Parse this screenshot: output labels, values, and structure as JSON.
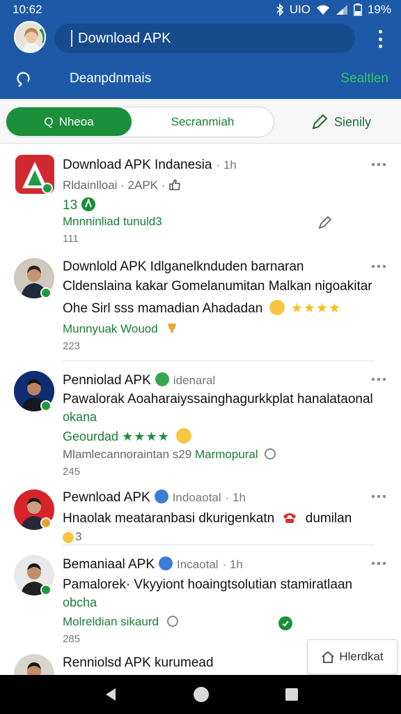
{
  "status_bar": {
    "time": "10:62",
    "network": "UIO",
    "battery": "19%"
  },
  "app_bar": {
    "search_text": "Download APK"
  },
  "sub_bar": {
    "title": "Deanpdnmais",
    "action": "Sealtlen"
  },
  "filters": {
    "active_label": "Nheoa",
    "active_prefix": "Q",
    "inactive_label": "Secranmiah",
    "right_label": "Sienily"
  },
  "feed": [
    {
      "title": "Download APK Indanesia",
      "time": "· 1h",
      "line1": "Rldainlloai · 2APK ·",
      "line2_num": "13",
      "line3": "Mnnninliad tunuld3",
      "count": "111"
    },
    {
      "title": "Downlold APK Idlganelknduden barnaran",
      "line1": "Cldenslaina kakar Gomelanumitan Malkan nigoakitar",
      "line2": "Ohe Sirl sss mamadian Ahadadan",
      "line3": "Munnyuak Wouod",
      "count": "223"
    },
    {
      "title": "Penniolad APK",
      "meta": "idenaral",
      "line1": "Pawalorak Aoaharaiyssainghagurkkplat hanalataonal",
      "line1b": "okana",
      "line2": "Geourdad",
      "line3": "Mlamlecannoraintan s29",
      "line3_green": "Marmopural",
      "count": "245"
    },
    {
      "title": "Pewnload APK",
      "meta": "Indoaotal",
      "time": "· 1h",
      "line1": "Hnaolak meataranbasi dkurigenkatn",
      "line1_tail": "dumilan",
      "line2": "3"
    },
    {
      "title": "Bemaniaal APK",
      "meta": "Incaotal",
      "time": "· 1h",
      "line1": "Pamalorek· Vkyyiont hoaingtsolutian stamiratlaan",
      "line1b": "obcha",
      "line3": "Molreldian sikaurd",
      "count": "285"
    },
    {
      "title": "Renniolsd APK kurumead"
    }
  ],
  "float_button": {
    "label": "Hlerdkat"
  },
  "colors": {
    "primary_blue": "#1d59a6",
    "accent_green": "#1b8f3a",
    "star_yellow": "#f2c01d"
  }
}
